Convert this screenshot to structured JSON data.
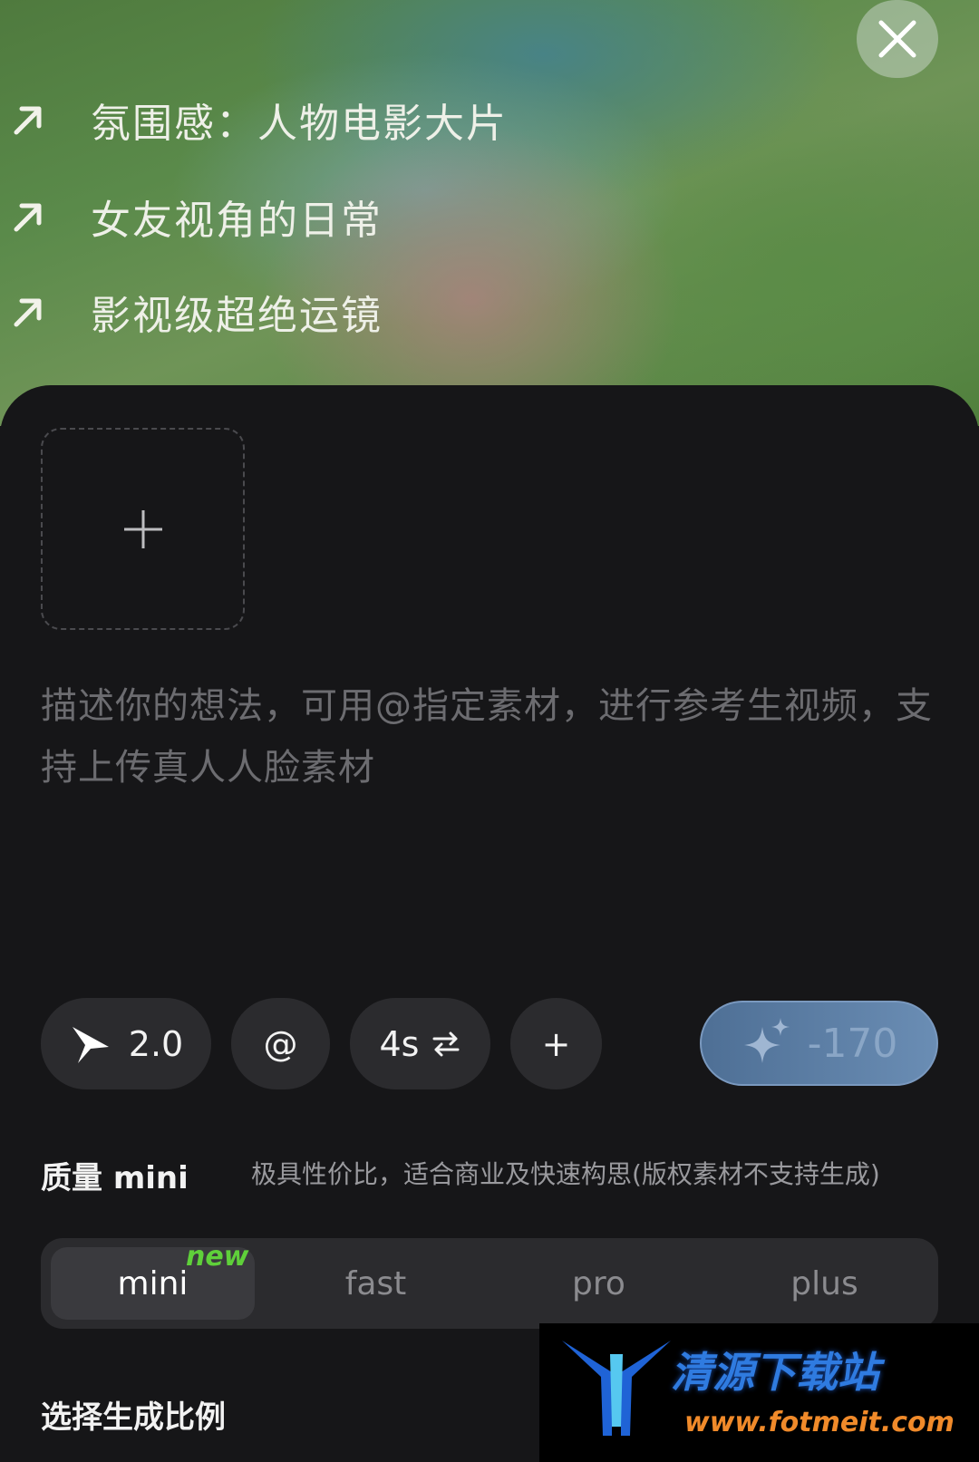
{
  "suggestions": [
    {
      "label": "氛围感：人物电影大片"
    },
    {
      "label": "女友视角的日常"
    },
    {
      "label": "影视级超绝运镜"
    }
  ],
  "prompt_placeholder": "描述你的想法，可用@指定素材，进行参考生视频，支持上传真人人脸素材",
  "toolbar": {
    "model_version": "2.0",
    "mention_label": "@",
    "duration_label": "4s",
    "more_label": "+",
    "generate_cost": "-170"
  },
  "quality": {
    "title": "质量 mini",
    "description": "极具性价比，适合商业及快速构思(版权素材不支持生成)",
    "options": [
      "mini",
      "fast",
      "pro",
      "plus"
    ],
    "selected": "mini",
    "new_badge": "new"
  },
  "ratio_title": "选择生成比例",
  "watermark": {
    "title": "清源下载站",
    "url": "www.fotmeit.com"
  },
  "colors": {
    "accent_blue": "#6a8db4",
    "new_green": "#5fd03a",
    "panel_bg": "#161618"
  }
}
